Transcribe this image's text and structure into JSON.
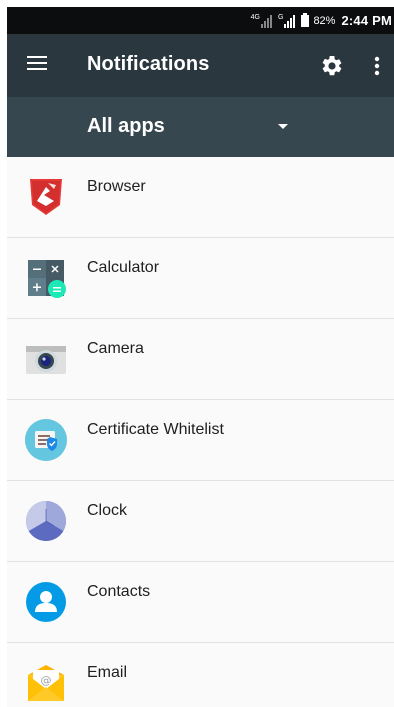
{
  "status_bar": {
    "network_left": "4G",
    "network_right": "G",
    "battery_percent": "82%",
    "time": "2:44 PM"
  },
  "toolbar": {
    "title": "Notifications",
    "menu_icon": "hamburger-menu-icon",
    "settings_icon": "gear-icon",
    "overflow_icon": "more-vert-icon",
    "background": "#2b373e"
  },
  "filter": {
    "selected": "All apps",
    "background": "#37474f"
  },
  "apps": [
    {
      "label": "Browser",
      "icon": "browser-icon"
    },
    {
      "label": "Calculator",
      "icon": "calculator-icon"
    },
    {
      "label": "Camera",
      "icon": "camera-icon"
    },
    {
      "label": "Certificate Whitelist",
      "icon": "certificate-whitelist-icon"
    },
    {
      "label": "Clock",
      "icon": "clock-icon"
    },
    {
      "label": "Contacts",
      "icon": "contacts-icon"
    },
    {
      "label": "Email",
      "icon": "email-icon"
    }
  ]
}
